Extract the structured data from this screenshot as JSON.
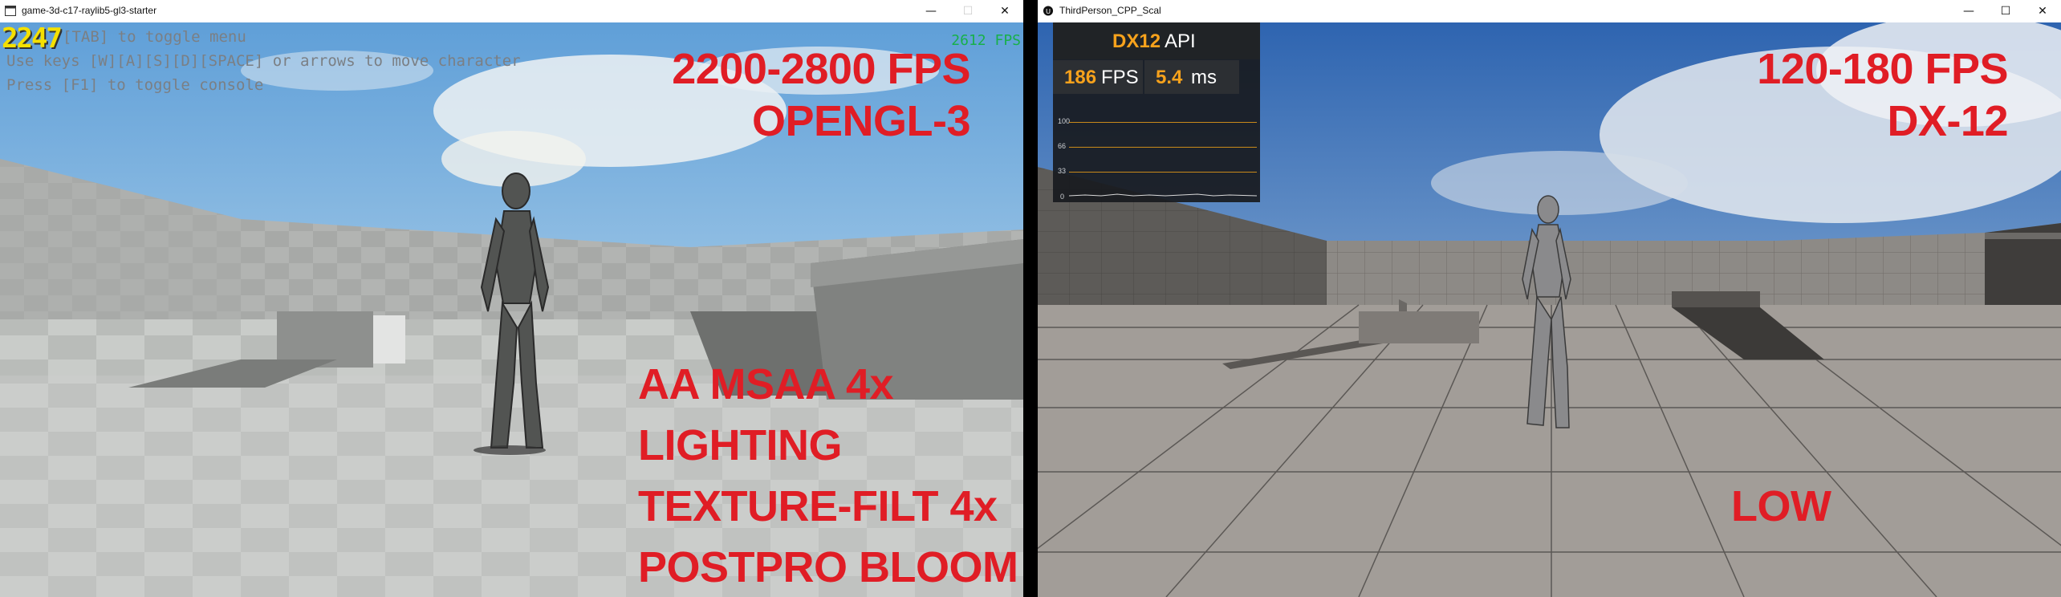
{
  "left_window": {
    "title": "game-3d-c17-raylib5-gl3-starter",
    "titlebar_buttons": {
      "minimize": "—",
      "maximize": "☐",
      "close": "✕"
    },
    "fps_counter": "2247",
    "fps_small": "2612 FPS",
    "help_lines": [
      "[TAB] to toggle menu",
      "Use keys [W][A][S][D][SPACE] or arrows to move character",
      "Press [F1] to toggle console"
    ],
    "overlay": {
      "fps_range": "2200-2800 FPS",
      "api": "OPENGL-3",
      "settings": [
        "AA MSAA 4x",
        "LIGHTING",
        "TEXTURE-FILT 4x",
        "POSTPRO BLOOM"
      ]
    }
  },
  "right_window": {
    "title": "ThirdPerson_CPP_Scal",
    "titlebar_buttons": {
      "minimize": "—",
      "maximize": "☐",
      "close": "✕"
    },
    "perf_panel": {
      "api_name": "DX12",
      "api_label": "API",
      "fps_value": "186",
      "fps_unit": "FPS",
      "ms_value": "5.4",
      "ms_unit": "ms",
      "graph_labels": [
        "100",
        "66",
        "33",
        "0"
      ]
    },
    "overlay": {
      "fps_range": "120-180 FPS",
      "api": "DX-12",
      "quality": "LOW"
    }
  },
  "colors": {
    "overlay_red": "#e01d25",
    "dx_orange": "#f7a21c",
    "fps_green": "#18b04a",
    "counter_yellow": "#f5e000"
  },
  "icons": {
    "left_app": "window-app-icon",
    "right_app": "unreal-engine-icon"
  }
}
